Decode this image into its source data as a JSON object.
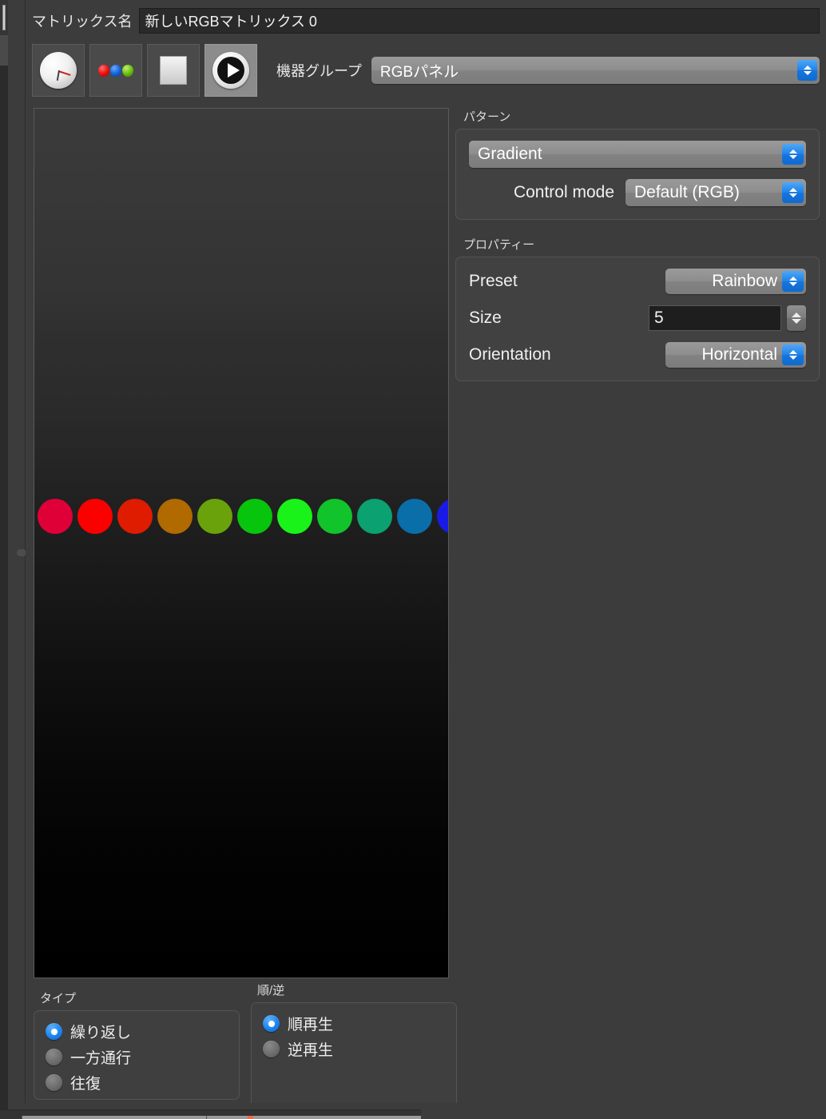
{
  "window": {
    "background_color": "#3c3c3c"
  },
  "name_row": {
    "label": "マトリックス名",
    "value": "新しいRGBマトリックス 0",
    "placeholder": "マトリックス名"
  },
  "toolbar": {
    "buttons": [
      {
        "name": "clock",
        "icon": "clock-icon",
        "active": false
      },
      {
        "name": "rgb",
        "icon": "rgb-balls-icon",
        "active": false
      },
      {
        "name": "stop",
        "icon": "stop-square-icon",
        "active": false
      },
      {
        "name": "play",
        "icon": "play-icon",
        "active": true
      }
    ],
    "device_group_label": "機器グループ",
    "device_group_value": "RGBパネル"
  },
  "pattern_group": {
    "title": "パターン",
    "pattern_value": "Gradient",
    "control_mode_label": "Control mode",
    "control_mode_value": "Default (RGB)"
  },
  "properties_group": {
    "title": "プロパティー",
    "preset_label": "Preset",
    "preset_value": "Rainbow",
    "size_label": "Size",
    "size_value": "5",
    "orientation_label": "Orientation",
    "orientation_value": "Horizontal"
  },
  "type_group": {
    "title": "タイプ",
    "options": [
      {
        "label": "繰り返し",
        "selected": true
      },
      {
        "label": "一方通行",
        "selected": false
      },
      {
        "label": "往復",
        "selected": false
      }
    ]
  },
  "direction_group": {
    "title": "順/逆",
    "options": [
      {
        "label": "順再生",
        "selected": true
      },
      {
        "label": "逆再生",
        "selected": false
      }
    ]
  },
  "preview": {
    "dot_colors": [
      "#e00038",
      "#fc0000",
      "#df1c00",
      "#b06a00",
      "#6aa20c",
      "#07c40c",
      "#19f319",
      "#11c42b",
      "#0ba170",
      "#0a6ea8",
      "#1a1ae6"
    ],
    "dot_count": 11,
    "gradient_top_color": "#3b3b3b",
    "gradient_bottom_color": "#000000"
  },
  "colors": {
    "accent_blue": "#1b84ee",
    "panel_bg": "#414141",
    "window_bg": "#3c3c3c",
    "field_bg": "#1e1e1e"
  }
}
